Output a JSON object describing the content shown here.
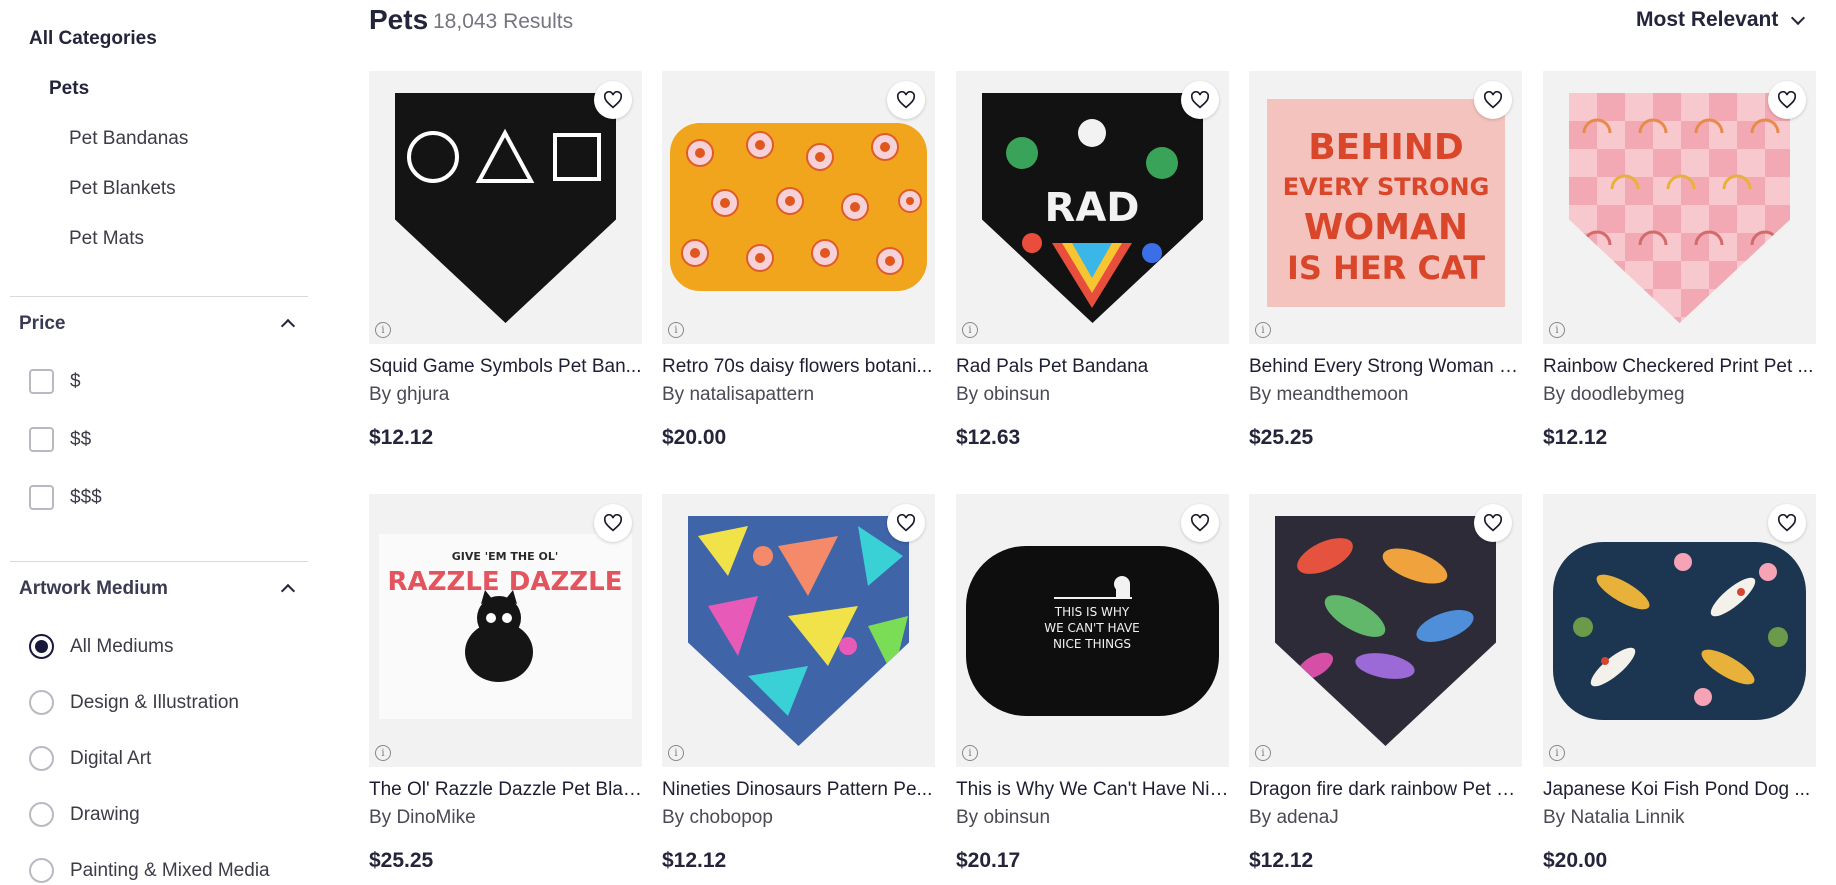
{
  "sidebar": {
    "all_categories": "All Categories",
    "current_category": "Pets",
    "subcategories": [
      "Pet Bandanas",
      "Pet Blankets",
      "Pet Mats"
    ],
    "price": {
      "title": "Price",
      "options": [
        "$",
        "$$",
        "$$$"
      ]
    },
    "artwork_medium": {
      "title": "Artwork Medium",
      "options": [
        "All Mediums",
        "Design & Illustration",
        "Digital Art",
        "Drawing",
        "Painting & Mixed Media"
      ],
      "selected": "All Mediums"
    }
  },
  "header": {
    "title": "Pets",
    "count": "18,043 Results",
    "sort": "Most Relevant"
  },
  "products": [
    {
      "title": "Squid Game Symbols Pet Ban...",
      "artist": "By ghjura",
      "price": "$12.12"
    },
    {
      "title": "Retro 70s daisy flowers botani...",
      "artist": "By natalisapattern",
      "price": "$20.00"
    },
    {
      "title": "Rad Pals Pet Bandana",
      "artist": "By obinsun",
      "price": "$12.63",
      "art_text": "RAD"
    },
    {
      "title": "Behind Every Strong Woman P...",
      "artist": "By meandthemoon",
      "price": "$25.25",
      "art_text": [
        "BEHIND",
        "EVERY STRONG",
        "WOMAN",
        "IS HER CAT"
      ]
    },
    {
      "title": "Rainbow Checkered Print Pet ...",
      "artist": "By doodlebymeg",
      "price": "$12.12"
    },
    {
      "title": "The Ol' Razzle Dazzle Pet Blan...",
      "artist": "By DinoMike",
      "price": "$25.25",
      "art_text": [
        "GIVE 'EM THE OL'",
        "RAZZLE DAZZLE"
      ]
    },
    {
      "title": "Nineties Dinosaurs Pattern Pe...",
      "artist": "By chobopop",
      "price": "$12.12"
    },
    {
      "title": "This is Why We Can't Have Nic...",
      "artist": "By obinsun",
      "price": "$20.17",
      "art_text": [
        "THIS IS WHY",
        "WE CAN'T HAVE",
        "NICE THINGS"
      ]
    },
    {
      "title": "Dragon fire dark rainbow Pet B...",
      "artist": "By adenaJ",
      "price": "$12.12"
    },
    {
      "title": "Japanese Koi Fish Pond Dog ...",
      "artist": "By Natalia Linnik",
      "price": "$20.00"
    }
  ],
  "icons": {
    "favorite": "heart-outline-icon",
    "info": "info-icon",
    "expand": "chevron-up-icon",
    "sort": "chevron-down-icon"
  },
  "colors": {
    "text_primary": "#24243a",
    "text_secondary": "#757580",
    "radio_selected": "#18183a"
  }
}
